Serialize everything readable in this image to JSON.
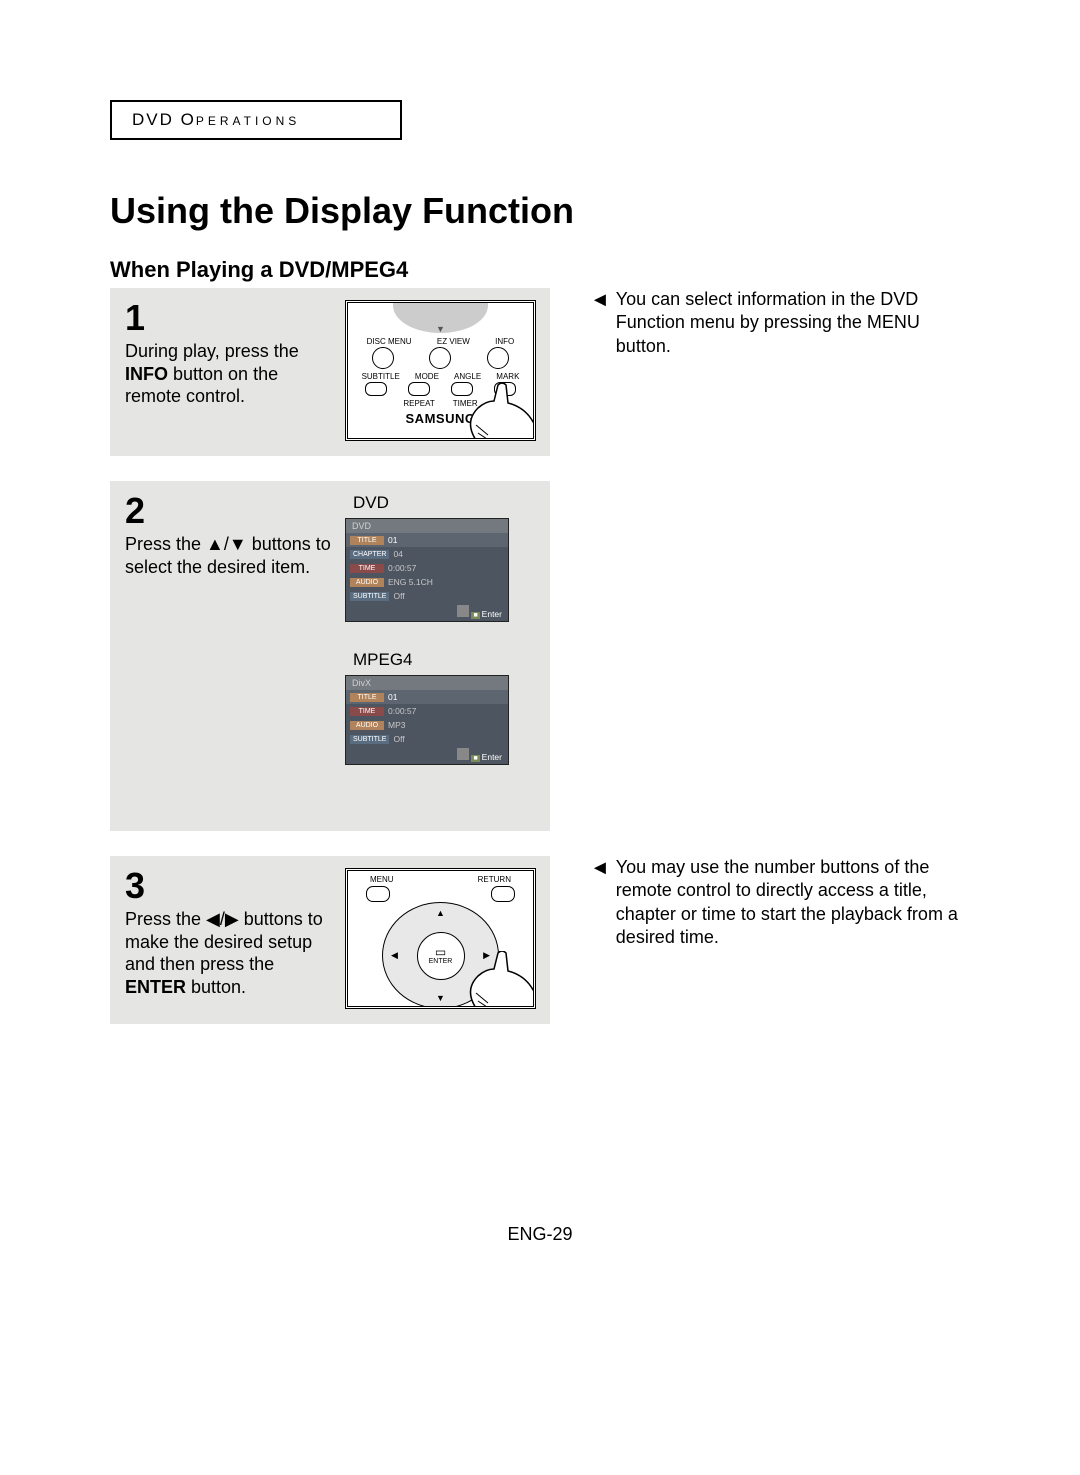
{
  "section_header": "DVD O",
  "section_header2": "PERATIONS",
  "title": "Using the Display Function",
  "subtitle": "When Playing a DVD/MPEG4",
  "steps": {
    "s1": {
      "num": "1",
      "text_pre": "During play, press the ",
      "bold": "INFO",
      "text_post": " button on the remote control."
    },
    "s2": {
      "num": "2",
      "text_pre": "Press the ",
      "symbol": "▲/▼",
      "text_post": " buttons to select the desired item."
    },
    "s3": {
      "num": "3",
      "text_pre": "Press the ",
      "symbol": "◀/▶",
      "text_post": " buttons to make the desired setup and then press the ",
      "bold": "ENTER",
      "text_post2": " button."
    }
  },
  "notes": {
    "n1": "You can select information in the DVD Function menu by pressing the MENU button.",
    "n3": "You may use the number buttons of the remote control to directly access a title, chapter or time to start the playback from a desired time."
  },
  "remote1": {
    "row1": [
      "DISC MENU",
      "EZ VIEW",
      "INFO"
    ],
    "row2": [
      "SUBTITLE",
      "MODE",
      "ANGLE",
      "MARK"
    ],
    "row3": [
      "REPEAT",
      "TIMER"
    ],
    "brand": "SAMSUNG"
  },
  "remote3": {
    "menu": "MENU",
    "return": "RETURN",
    "enter": "ENTER"
  },
  "osd_dvd": {
    "label": "DVD",
    "head": "DVD",
    "rows": [
      {
        "tag": "TITLE",
        "val": "01"
      },
      {
        "tag": "CHAPTER",
        "val": "04"
      },
      {
        "tag": "TIME",
        "val": "0:00:57"
      },
      {
        "tag": "AUDIO",
        "val": "ENG 5.1CH"
      },
      {
        "tag": "SUBTITLE",
        "val": "Off"
      }
    ],
    "enter": "Enter"
  },
  "osd_mpeg4": {
    "label": "MPEG4",
    "head": "DivX",
    "rows": [
      {
        "tag": "TITLE",
        "val": "01"
      },
      {
        "tag": "TIME",
        "val": "0:00:57"
      },
      {
        "tag": "AUDIO",
        "val": "MP3"
      },
      {
        "tag": "SUBTITLE",
        "val": "Off"
      }
    ],
    "enter": "Enter"
  },
  "footer": "ENG-29"
}
